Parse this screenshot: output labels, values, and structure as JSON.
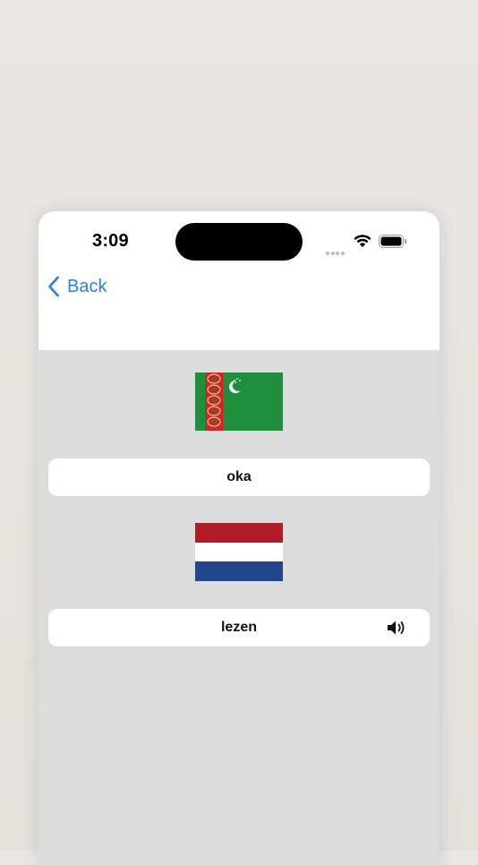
{
  "status_bar": {
    "time": "3:09"
  },
  "nav": {
    "back_label": "Back",
    "accent_color": "#2f7fe0"
  },
  "cards": [
    {
      "flag": "turkmenistan-flag",
      "text": "oka",
      "has_speaker": false
    },
    {
      "flag": "netherlands-flag",
      "text": "lezen",
      "has_speaker": true,
      "speaker_icon": "speaker-icon"
    }
  ],
  "colors": {
    "background": "#e7e4e0",
    "content_background": "#dcdcdc",
    "card_background": "#ffffff",
    "tm_green": "#1f8f3e",
    "tm_red": "#c8282c",
    "nl_red": "#ae1c28",
    "nl_white": "#ffffff",
    "nl_blue": "#21468b"
  }
}
